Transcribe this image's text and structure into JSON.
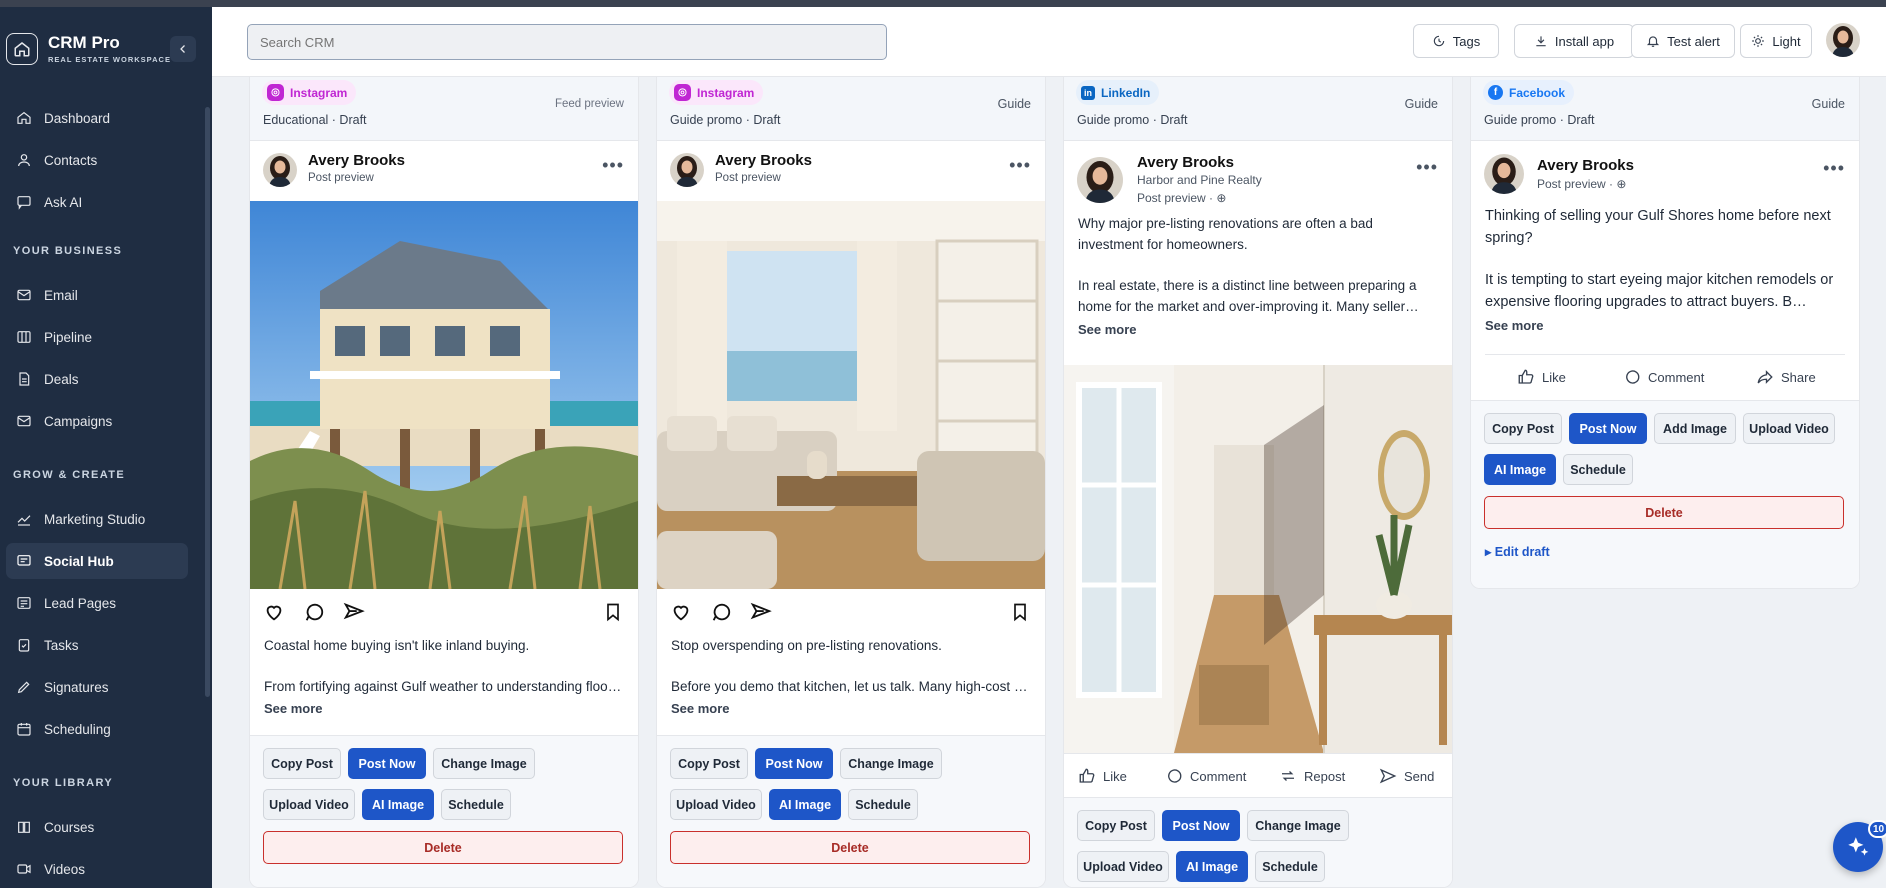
{
  "brand": {
    "name": "CRM Pro",
    "subtitle": "REAL ESTATE WORKSPACE"
  },
  "nav": {
    "items_top": [
      {
        "label": "Dashboard",
        "icon": "home-icon"
      },
      {
        "label": "Contacts",
        "icon": "user-icon"
      },
      {
        "label": "Ask AI",
        "icon": "chat-icon"
      }
    ],
    "heading_business": "YOUR BUSINESS",
    "items_business": [
      {
        "label": "Email",
        "icon": "mail-icon"
      },
      {
        "label": "Pipeline",
        "icon": "columns-icon"
      },
      {
        "label": "Deals",
        "icon": "document-icon"
      },
      {
        "label": "Campaigns",
        "icon": "mail-icon"
      }
    ],
    "heading_grow": "GROW & CREATE",
    "items_grow": [
      {
        "label": "Marketing Studio",
        "icon": "trend-icon"
      },
      {
        "label": "Social Hub",
        "icon": "message-icon",
        "active": true
      },
      {
        "label": "Lead Pages",
        "icon": "layout-icon"
      },
      {
        "label": "Tasks",
        "icon": "clipboard-check-icon"
      },
      {
        "label": "Signatures",
        "icon": "pen-icon"
      },
      {
        "label": "Scheduling",
        "icon": "calendar-icon"
      }
    ],
    "heading_library": "YOUR LIBRARY",
    "items_library": [
      {
        "label": "Courses",
        "icon": "book-icon"
      },
      {
        "label": "Videos",
        "icon": "video-icon"
      }
    ]
  },
  "header": {
    "search_placeholder": "Search CRM",
    "tags": "Tags",
    "install": "Install app",
    "test_alert": "Test alert",
    "theme": "Light"
  },
  "cards": [
    {
      "platform": "Instagram",
      "meta": "Educational · Draft",
      "tag": "Feed preview",
      "author": "Avery Brooks",
      "subtitle": "Post preview",
      "line1": "Coastal home buying isn't like inland buying.",
      "line2": "From fortifying against Gulf weather to understanding flood zones and elevation certificates, coastal purchases need a specialist.",
      "see_more": "See more",
      "buttons": {
        "copy": "Copy Post",
        "post": "Post Now",
        "change": "Change Image",
        "upload": "Upload Video",
        "ai": "AI Image",
        "schedule": "Schedule",
        "delete": "Delete"
      }
    },
    {
      "platform": "Instagram",
      "meta": "Guide promo · Draft",
      "tag": "Guide",
      "author": "Avery Brooks",
      "subtitle": "Post preview",
      "line1": "Stop overspending on pre-listing renovations.",
      "line2": "Before you demo that kitchen, let us talk. Many high-cost upgrades never pay back at closing.",
      "see_more": "See more",
      "buttons": {
        "copy": "Copy Post",
        "post": "Post Now",
        "change": "Change Image",
        "upload": "Upload Video",
        "ai": "AI Image",
        "schedule": "Schedule",
        "delete": "Delete"
      }
    },
    {
      "platform": "LinkedIn",
      "meta": "Guide promo · Draft",
      "tag": "Guide",
      "author": "Avery Brooks",
      "company": "Harbor and Pine Realty",
      "subtitle": "Post preview ·",
      "para1": "Why major pre-listing renovations are often a bad investment for homeowners.",
      "para2": "In real estate, there is a distinct line between preparing a home for the market and over-improving it. Many seller…",
      "see_more": "See more",
      "social": {
        "like": "Like",
        "comment": "Comment",
        "repost": "Repost",
        "send": "Send"
      },
      "buttons": {
        "copy": "Copy Post",
        "post": "Post Now",
        "change": "Change Image",
        "upload": "Upload Video",
        "ai": "AI Image",
        "schedule": "Schedule"
      }
    },
    {
      "platform": "Facebook",
      "meta": "Guide promo · Draft",
      "tag": "Guide",
      "author": "Avery Brooks",
      "subtitle": "Post preview ·",
      "para1": "Thinking of selling your Gulf Shores home before next spring?",
      "para2": "It is tempting to start eyeing major kitchen remodels or expensive flooring upgrades to attract buyers. B…",
      "see_more": "See more",
      "social": {
        "like": "Like",
        "comment": "Comment",
        "share": "Share"
      },
      "buttons": {
        "copy": "Copy Post",
        "post": "Post Now",
        "add": "Add Image",
        "upload": "Upload Video",
        "ai": "AI Image",
        "schedule": "Schedule",
        "delete": "Delete"
      },
      "edit_draft": "▸ Edit draft"
    }
  ],
  "fab": {
    "badge": "10",
    "icon": "sparkles-icon"
  },
  "colors": {
    "sidebar": "#1f2d42",
    "primary": "#1e56c8",
    "instagram": "#c026d3",
    "linkedin": "#0a66c2",
    "facebook": "#1877f2",
    "danger": "#c9302c"
  }
}
